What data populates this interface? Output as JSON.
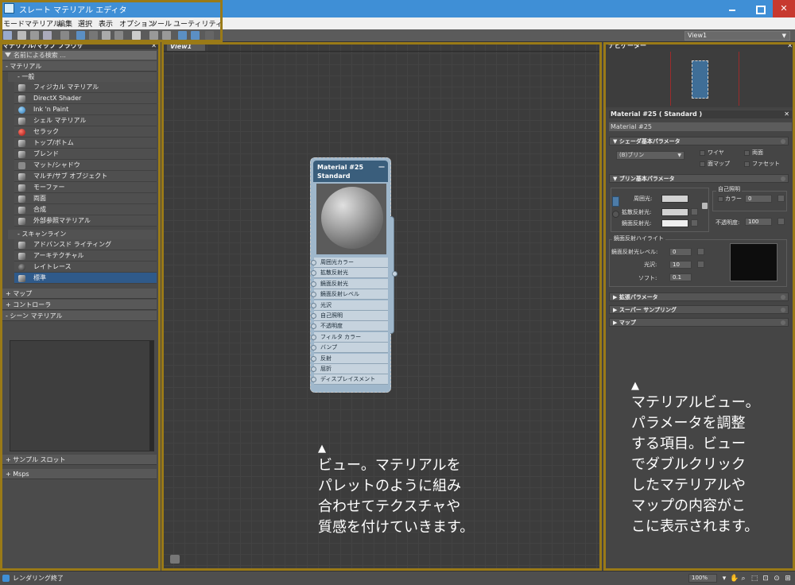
{
  "window": {
    "title": "スレート マテリアル エディタ"
  },
  "menu": [
    "モード",
    "マテリアル",
    "編集",
    "選択",
    "表示",
    "オプション",
    "ツール",
    "ユーティリティ"
  ],
  "toolbar": {
    "view_select": "View1"
  },
  "browser": {
    "title": "マテリアル/マップ ブラウザ",
    "search_placeholder": "名前による検索 ...",
    "category_materials": "- マテリアル",
    "group_general": "- 一般",
    "general_items": [
      {
        "label": "フィジカル マテリアル",
        "icon": "sphere"
      },
      {
        "label": "DirectX Shader",
        "icon": "sphere"
      },
      {
        "label": "Ink 'n Paint",
        "icon": "blue-ball"
      },
      {
        "label": "シェル マテリアル",
        "icon": "sphere"
      },
      {
        "label": "セラック",
        "icon": "red-ball"
      },
      {
        "label": "トップ/ボトム",
        "icon": "sphere"
      },
      {
        "label": "ブレンド",
        "icon": "sphere"
      },
      {
        "label": "マット/シャドウ",
        "icon": "flat"
      },
      {
        "label": "マルチ/サブ オブジェクト",
        "icon": "sphere"
      },
      {
        "label": "モーファー",
        "icon": "sphere"
      },
      {
        "label": "両面",
        "icon": "sphere"
      },
      {
        "label": "合成",
        "icon": "sphere"
      },
      {
        "label": "外部参照マテリアル",
        "icon": "sphere"
      }
    ],
    "group_scanline": "- スキャンライン",
    "scanline_items": [
      {
        "label": "アドバンスド ライティング",
        "icon": "sphere"
      },
      {
        "label": "アーキテクチャル",
        "icon": "sphere"
      },
      {
        "label": "レイトレース",
        "icon": "dark-sphere"
      },
      {
        "label": "標準",
        "icon": "sphere"
      }
    ],
    "category_maps": "+ マップ",
    "category_controllers": "+ コントローラ",
    "category_scene": "- シーン マテリアル",
    "category_samples": "+ サンプル スロット",
    "category_msps": "+ Msps"
  },
  "view": {
    "tab": "View1"
  },
  "node": {
    "title": "Material #25",
    "subtitle": "Standard",
    "slots": [
      "周囲光カラー",
      "拡散反射光",
      "鏡面反射光",
      "鏡面反射レベル",
      "光沢",
      "自己照明",
      "不透明度",
      "フィルタ カラー",
      "バンプ",
      "反射",
      "屈折",
      "ディスプレイスメント"
    ]
  },
  "navigator": {
    "title": "ナビゲーター"
  },
  "params": {
    "title": "Material #25  ( Standard )",
    "name_value": "Material #25",
    "rollout_shader": "シェーダ基本パラメータ",
    "shader_value": "(B)ブリン",
    "cb_wire": "ワイヤ",
    "cb_twosided": "両面",
    "cb_facemap": "面マップ",
    "cb_faceted": "ファセット",
    "rollout_blinn": "ブリン基本パラメータ",
    "ambient": "周囲光:",
    "diffuse": "拡散反射光:",
    "specular": "鏡面反射光:",
    "self_illum_group": "自己照明",
    "self_illum_color": "カラー",
    "self_illum_value": "0",
    "opacity_label": "不透明度:",
    "opacity_value": "100",
    "spec_group": "鏡面反射ハイライト",
    "spec_level": "鏡面反射光レベル:",
    "spec_level_value": "0",
    "gloss": "光沢:",
    "gloss_value": "10",
    "soften": "ソフト:",
    "soften_value": "0.1",
    "rollout_extended": "拡張パラメータ",
    "rollout_supersampling": "スーパー サンプリング",
    "rollout_maps": "マップ"
  },
  "status": {
    "text": "レンダリング終了",
    "zoom": "100%"
  },
  "annotations": {
    "view_marker": "▲",
    "view_lines": [
      "ビュー。マテリアルを",
      "パレットのように組み",
      "合わせてテクスチャや",
      "質感を付けていきます。"
    ],
    "mat_marker": "▲",
    "mat_lines": [
      "マテリアルビュー。",
      "パラメータを調整",
      "する項目。ビュー",
      "でダブルクリック",
      "したマテリアルや",
      "マップの内容がこ",
      "こに表示されます。"
    ]
  },
  "colors": {
    "frame": "#9a7a17",
    "titlebar": "#3f8fd6",
    "selected": "#2f5a8a",
    "node_header": "#3a5e7c"
  }
}
